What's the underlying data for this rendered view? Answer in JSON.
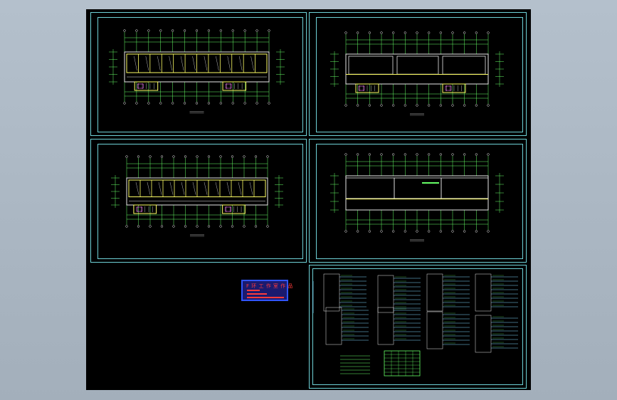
{
  "stamp": {
    "title": "F 环 工 作 室 作 品"
  },
  "colors": {
    "background": "#a9b5c1",
    "canvas": "#000000",
    "frame": "#6fd3d8",
    "walls": "#ffff66",
    "grid": "#66ff66",
    "stamp_bg": "#1a1a6e",
    "stamp_text": "#ff3b3b"
  }
}
